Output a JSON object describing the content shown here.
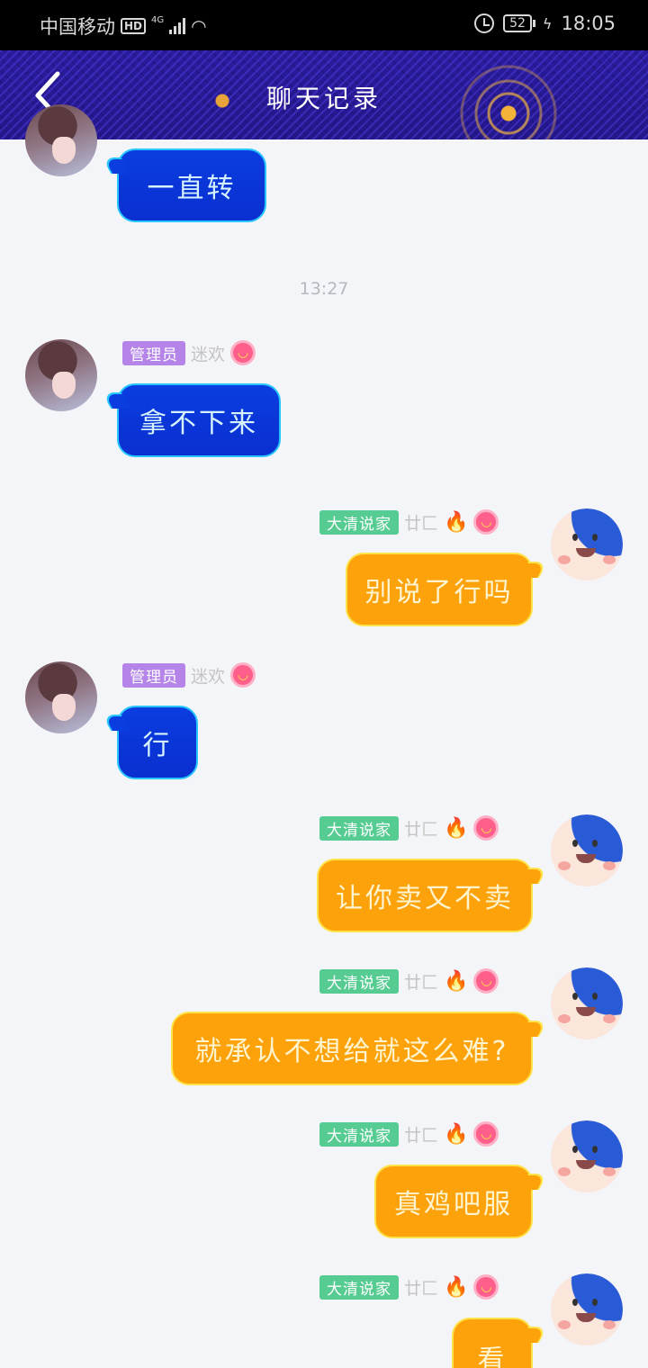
{
  "status_bar": {
    "carrier": "中国移动",
    "hd": "HD",
    "network": "4G",
    "battery": "52",
    "time": "18:05"
  },
  "header": {
    "title": "聊天记录"
  },
  "timestamp": "13:27",
  "badges": {
    "admin": "管理员",
    "talker": "大清说家"
  },
  "nicknames": {
    "left": "迷欢",
    "right": "廿匚"
  },
  "messages": [
    {
      "side": "left",
      "text": "一直转"
    },
    {
      "side": "left",
      "text": "拿不下来"
    },
    {
      "side": "right",
      "text": "别说了行吗"
    },
    {
      "side": "left",
      "text": "行"
    },
    {
      "side": "right",
      "text": "让你卖又不卖"
    },
    {
      "side": "right",
      "text": "就承认不想给就这么难?"
    },
    {
      "side": "right",
      "text": "真鸡吧服"
    },
    {
      "side": "right",
      "text": "看"
    }
  ],
  "colors": {
    "left_bubble": "#0a3ddf",
    "right_bubble": "#fda20a",
    "admin_badge": "#b584e8",
    "talker_badge": "#57cc92"
  }
}
